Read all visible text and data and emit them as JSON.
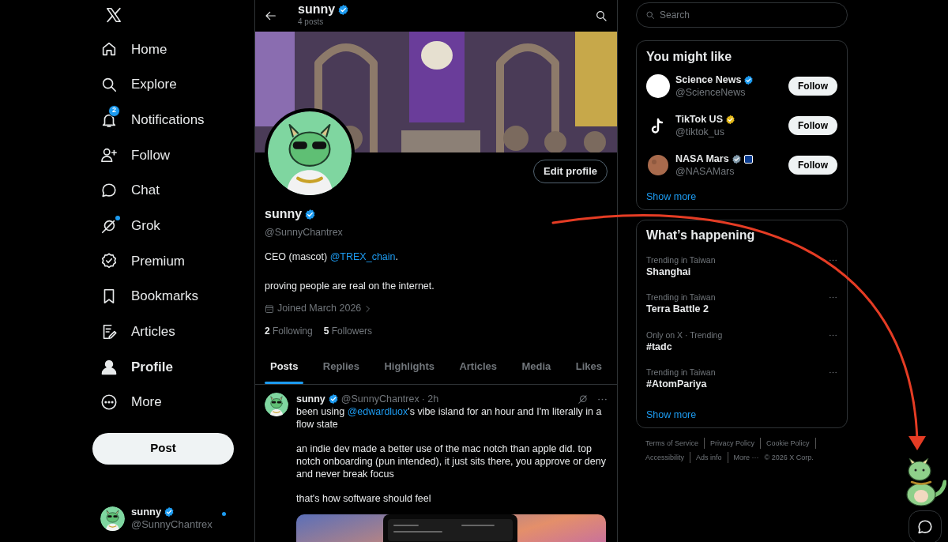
{
  "sidebar": {
    "items": [
      {
        "label": "Home",
        "kind": "home",
        "selected": false,
        "dot": false
      },
      {
        "label": "Explore",
        "kind": "explore",
        "selected": false,
        "dot": false
      },
      {
        "label": "Notifications",
        "kind": "bell",
        "selected": false,
        "dot": false,
        "badge": "2"
      },
      {
        "label": "Follow",
        "kind": "follow",
        "selected": false,
        "dot": false
      },
      {
        "label": "Chat",
        "kind": "chat",
        "selected": false,
        "dot": false
      },
      {
        "label": "Grok",
        "kind": "grok",
        "selected": false,
        "dot": true
      },
      {
        "label": "Premium",
        "kind": "premium",
        "selected": false,
        "dot": false
      },
      {
        "label": "Bookmarks",
        "kind": "bookmark",
        "selected": false,
        "dot": false
      },
      {
        "label": "Articles",
        "kind": "articles",
        "selected": false,
        "dot": false
      },
      {
        "label": "Profile",
        "kind": "profile",
        "selected": true,
        "dot": false
      },
      {
        "label": "More",
        "kind": "more",
        "selected": false,
        "dot": false
      }
    ],
    "post_button": "Post",
    "account": {
      "name": "sunny",
      "handle": "@SunnyChantrex",
      "verified": true,
      "dot": true
    }
  },
  "header": {
    "name": "sunny",
    "verified": true,
    "posts": "4 posts"
  },
  "profile": {
    "edit_button": "Edit profile",
    "name": "sunny",
    "verified": true,
    "handle": "@SunnyChantrex",
    "bio": [
      {
        "kind": "text",
        "text": "CEO (mascot) "
      },
      {
        "kind": "mention",
        "text": "@TREX_chain"
      },
      {
        "kind": "text",
        "text": "."
      }
    ],
    "bio_2": "proving people are real on the internet.",
    "joined": "Joined March 2026",
    "following_count": "2",
    "following_label": "Following",
    "followers_count": "5",
    "followers_label": "Followers"
  },
  "tabs": [
    {
      "label": "Posts",
      "selected": true
    },
    {
      "label": "Replies",
      "selected": false
    },
    {
      "label": "Highlights",
      "selected": false
    },
    {
      "label": "Articles",
      "selected": false
    },
    {
      "label": "Media",
      "selected": false
    },
    {
      "label": "Likes",
      "selected": false
    }
  ],
  "post": {
    "name": "sunny",
    "verified": true,
    "handle": "@SunnyChantrex",
    "time": "· 2h",
    "paragraphs": [
      [
        {
          "kind": "text",
          "text": "been using "
        },
        {
          "kind": "mention",
          "text": "@edwardluox"
        },
        {
          "kind": "text",
          "text": "'s vibe island for an hour and I'm literally in a flow state"
        }
      ],
      [
        {
          "kind": "text",
          "text": "an indie dev made a better use of the mac notch than apple did. top notch onboarding (pun intended), it just sits there, you approve or deny and never break focus"
        }
      ],
      [
        {
          "kind": "text",
          "text": "that's how software should feel"
        }
      ]
    ],
    "has_media": true
  },
  "search": {
    "placeholder": "Search"
  },
  "suggestions": {
    "title": "You might like",
    "items": [
      {
        "name": "Science News",
        "handle": "@ScienceNews",
        "kind": "science",
        "color": "#1d9bf0",
        "button": "Follow"
      },
      {
        "name": "TikTok US",
        "handle": "@tiktok_us",
        "kind": "tiktok",
        "color": "#e2b719",
        "button": "Follow"
      },
      {
        "name": "NASA Mars",
        "handle": "@NASAMars",
        "kind": "planet",
        "color": "#829aab",
        "affiliate": true,
        "button": "Follow"
      }
    ],
    "show_more": "Show more"
  },
  "trends": {
    "title": "What’s happening",
    "items": [
      {
        "context": "Trending in Taiwan",
        "topic": "Shanghai"
      },
      {
        "context": "Trending in Taiwan",
        "topic": "Terra Battle 2"
      },
      {
        "context": "Only on X · Trending",
        "topic": "#tadc"
      },
      {
        "context": "Trending in Taiwan",
        "topic": "#AtomPariya"
      }
    ],
    "show_more": "Show more"
  },
  "footer": {
    "links": [
      "Terms of Service",
      "Privacy Policy",
      "Cookie Policy",
      "Accessibility",
      "Ads info",
      "More ···"
    ],
    "copyright": "© 2026 X Corp."
  }
}
